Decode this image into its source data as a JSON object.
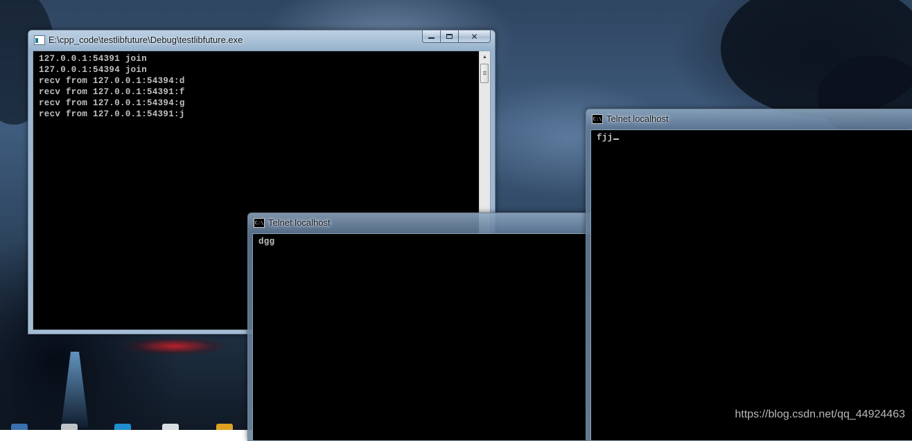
{
  "server_window": {
    "title": "E:\\cpp_code\\testlibfuture\\Debug\\testlibfuture.exe",
    "icon": "console-app-icon",
    "caption_buttons": {
      "minimize": "minimize-icon",
      "maximize": "maximize-icon",
      "close": "close-icon"
    },
    "output_lines": [
      "127.0.0.1:54391 join",
      "127.0.0.1:54394 join",
      "recv from 127.0.0.1:54394:d",
      "recv from 127.0.0.1:54391:f",
      "recv from 127.0.0.1:54394:g",
      "recv from 127.0.0.1:54391:j"
    ]
  },
  "telnet_window_1": {
    "title": "Telnet localhost",
    "icon": "cmd-icon",
    "text": "dgg"
  },
  "telnet_window_2": {
    "title": "Telnet localhost",
    "icon": "cmd-icon",
    "text": "fjj"
  },
  "watermark": "https://blog.csdn.net/qq_44924463",
  "colors": {
    "console_background": "#000000",
    "console_text": "#c0c0c0",
    "titlebar_glass": "#a5bdd5"
  }
}
